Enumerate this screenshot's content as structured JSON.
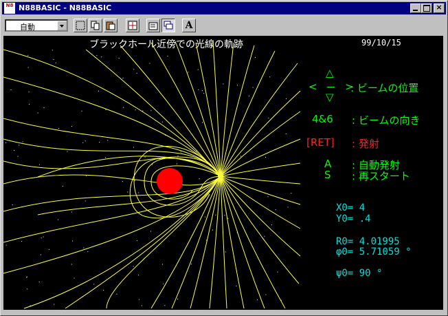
{
  "window": {
    "title": "N88BASIC - N88BASIC",
    "icon_label": "N8"
  },
  "toolbar": {
    "mode_value": "自動",
    "font_button_label": "A"
  },
  "screen": {
    "title": "ブラックホール近傍での光線の軌跡",
    "date": "99/10/15",
    "help": {
      "arrow_up": "△",
      "arrow_down": "▽",
      "angle_left": "<",
      "angle_right": ">",
      "dash": "－",
      "position_label": ": ビームの位置",
      "direction_key": "4&6",
      "direction_label": ": ビームの向き",
      "ret_key": "[RET]",
      "ret_label": ": 発射",
      "a_key": "A",
      "a_label": ": 自動発射",
      "s_key": "S",
      "s_label": ": 再スタート"
    },
    "params": {
      "x0": "X0= 4",
      "y0": "Y0= .4",
      "r0": "R0= 4.01995",
      "phi0": "φ0= 5.71059 °",
      "psi0": "ψ0= 90 °"
    }
  },
  "colors": {
    "beam": "#ffff40",
    "blackhole": "#ff0000",
    "background": "#000000"
  }
}
